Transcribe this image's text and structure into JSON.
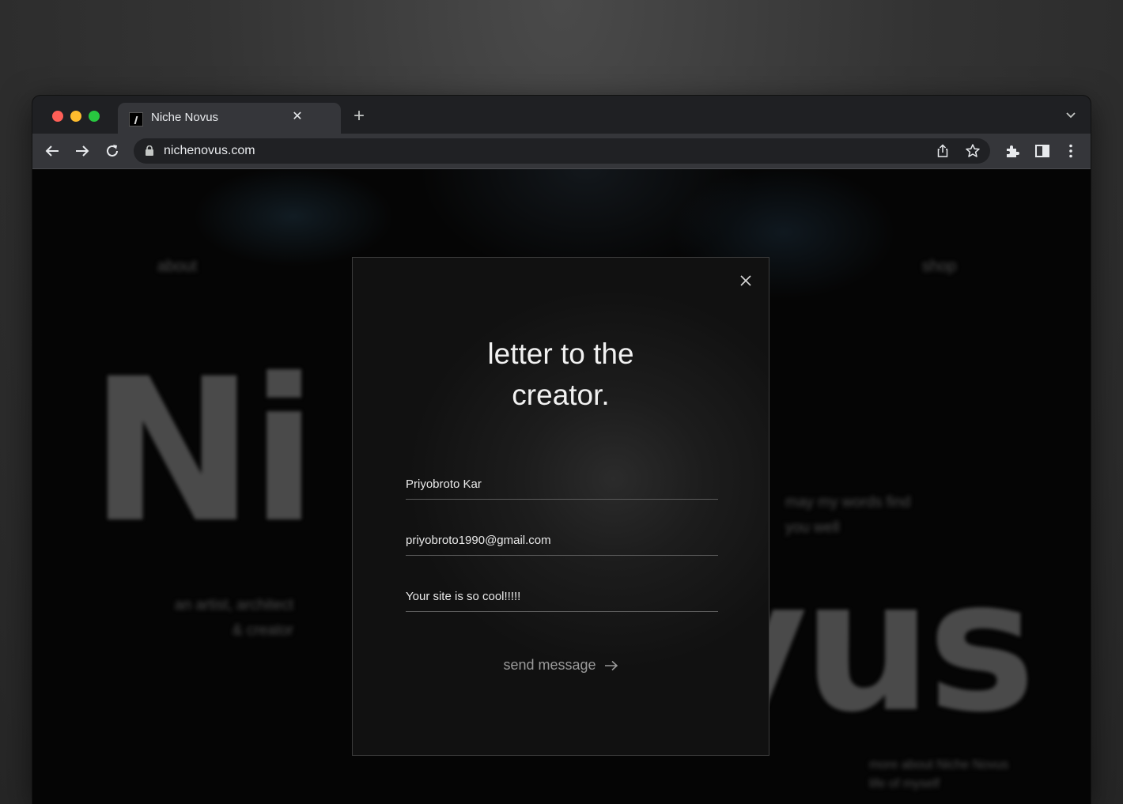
{
  "browser": {
    "tab": {
      "title": "Niche Novus",
      "close_glyph": "✕"
    },
    "new_tab_glyph": "+",
    "url": "nichenovus.com",
    "icons": [
      "back-arrow-icon",
      "forward-arrow-icon",
      "reload-icon",
      "lock-icon",
      "share-icon",
      "star-icon",
      "extensions-icon",
      "side-panel-icon",
      "kebab-menu-icon",
      "tab-search-chevron-icon"
    ]
  },
  "background": {
    "nav_left": "about",
    "nav_right": "shop",
    "big_left": "Ni",
    "big_right": "vus",
    "tagline": [
      "an artist, architect",
      "& creator"
    ],
    "quote": [
      "may my words find",
      "you well"
    ],
    "footer": [
      "more about Niche Novus",
      "life of myself"
    ]
  },
  "modal": {
    "title_line1": "letter to the",
    "title_line2": "creator.",
    "name_value": "Priyobroto Kar",
    "email_value": "priyobroto1990@gmail.com",
    "message_value": "Your site is so cool!!!!!",
    "send_label": "send message"
  },
  "colors": {
    "accent_red": "#ff5f57",
    "accent_yellow": "#febc2e",
    "accent_green": "#28c840"
  }
}
